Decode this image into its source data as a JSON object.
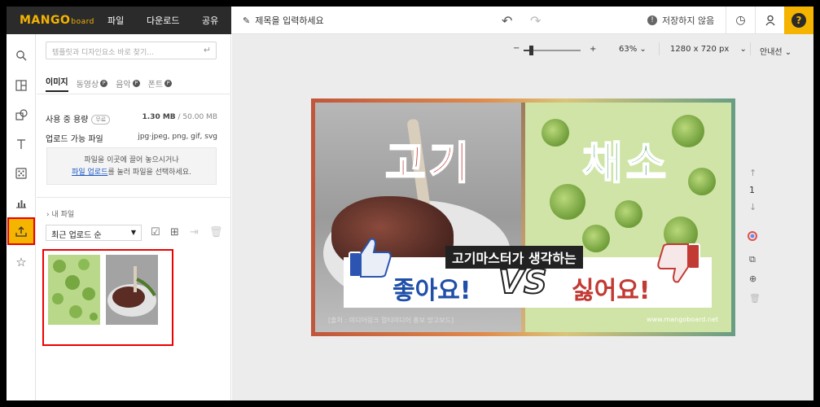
{
  "app": {
    "logo_main": "MANGO",
    "logo_sub": "board"
  },
  "topbar": {
    "menu": [
      "파일",
      "다운로드",
      "공유"
    ],
    "title_placeholder": "제목을 입력하세요",
    "save_status": "저장하지 않음"
  },
  "rail": {
    "items": [
      "search-icon",
      "layout-icon",
      "shapes-icon",
      "text-icon",
      "dice-icon",
      "chart-icon",
      "upload-icon",
      "star-icon"
    ],
    "active_index": 6
  },
  "panel": {
    "search_placeholder": "템플릿과 디자인요소 바로 찾기...",
    "tabs": [
      {
        "label": "이미지",
        "pro": ""
      },
      {
        "label": "동영상",
        "pro": "P"
      },
      {
        "label": "음악",
        "pro": "P"
      },
      {
        "label": "폰트",
        "pro": "P"
      }
    ],
    "usage_label": "사용 중 용량",
    "usage_badge": "무료",
    "usage_value": "1.30 MB",
    "usage_total": " / 50.00 MB",
    "types_label": "업로드 가능 파일",
    "types_value": "jpg·jpeg, png, gif, svg",
    "drop_line1": "파일을 이곳에 끌어 놓으시거나",
    "drop_link": "파일 업로드",
    "drop_line2": "를 눌러 파일을 선택하세요.",
    "myfiles": "내 파일",
    "sort": "최근 업로드 순"
  },
  "toolbar": {
    "zoom_minus": "−",
    "zoom_plus": "+",
    "zoom_level": "63%",
    "zoom_fraction": 0.63,
    "size": "1280 x 720 px",
    "guides": "안내선"
  },
  "canvas": {
    "left_title": "고기",
    "right_title": "채소",
    "banner_title": "고기마스터가 생각하는",
    "like_text": "좋아요!",
    "vs_text": "VS",
    "dislike_text": "싫어요!",
    "footer_left": "[출처 : 미디어링크 멀티미디어 홍보 망고보드]",
    "footer_right": "www.mangoboard.net"
  },
  "page_nav": {
    "page_number": "1"
  },
  "colors": {
    "accent": "#f5b400",
    "dark": "#2b2b2b",
    "highlight": "#e00000",
    "link": "#1a55c5"
  }
}
